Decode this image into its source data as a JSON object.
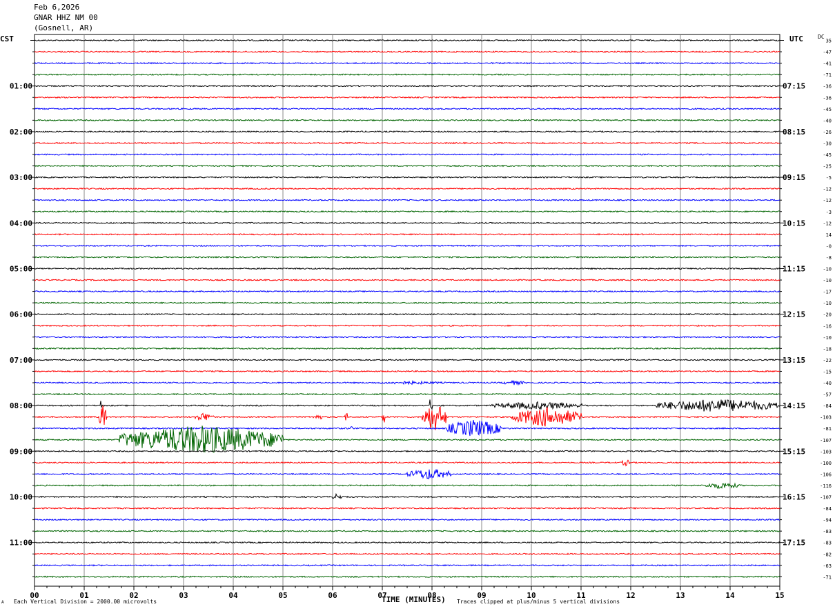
{
  "header": {
    "date": "Feb 6,2026",
    "station": "GNAR HHZ NM 00",
    "location": "(Gosnell, AR)"
  },
  "left_axis_title": "CST",
  "right_axis_title": "UTC",
  "dc_label": "DC",
  "footer": {
    "left_note": "Each Vertical Division = 2000.00 microvolts",
    "right_note": "Traces clipped at plus/minus 5 vertical divisions",
    "corner_mark": "A"
  },
  "chart_data": {
    "type": "line",
    "title": "",
    "xlabel": "TIME (MINUTES)",
    "xlim": [
      0,
      15
    ],
    "x_ticks": [
      "00",
      "01",
      "02",
      "03",
      "04",
      "05",
      "06",
      "07",
      "08",
      "09",
      "10",
      "11",
      "12",
      "13",
      "14",
      "15"
    ],
    "row_minutes": 15,
    "trace_colors": [
      "#000000",
      "#ff0000",
      "#0000ff",
      "#006400"
    ],
    "left_hour_labels": [
      "01:00",
      "02:00",
      "03:00",
      "04:00",
      "05:00",
      "06:00",
      "07:00",
      "08:00",
      "09:00",
      "10:00",
      "11:00"
    ],
    "right_hour_labels": [
      "07:15",
      "08:15",
      "09:15",
      "10:15",
      "11:15",
      "12:15",
      "13:15",
      "14:15",
      "15:15",
      "16:15",
      "17:15"
    ],
    "dc_offsets": [
      "35",
      "-47",
      "-41",
      "-71",
      "-36",
      "-36",
      "-45",
      "-40",
      "-26",
      "-30",
      "-45",
      "-25",
      "-5",
      "-12",
      "-12",
      "-3",
      "-12",
      "14",
      "-0",
      "-8",
      "-10",
      "-10",
      "-17",
      "-10",
      "-20",
      "-16",
      "-10",
      "-18",
      "-22",
      "-15",
      "-40",
      "-57",
      "-84",
      "-103",
      "-81",
      "-107",
      "-103",
      "-100",
      "-106",
      "-116",
      "-107",
      "-84",
      "-94",
      "-83",
      "-83",
      "-82",
      "-63",
      "-71"
    ],
    "events": [
      {
        "row": 32,
        "t_start": 9.2,
        "t_end": 11.1,
        "amplitude": 0.35
      },
      {
        "row": 32,
        "t_start": 12.5,
        "t_end": 15.0,
        "amplitude": 0.6
      },
      {
        "row": 32,
        "t_start": 1.3,
        "t_end": 1.35,
        "amplitude": 0.9
      },
      {
        "row": 32,
        "t_start": 7.95,
        "t_end": 8.0,
        "amplitude": 0.9
      },
      {
        "row": 33,
        "t_start": 1.3,
        "t_end": 1.45,
        "amplitude": 1.2
      },
      {
        "row": 33,
        "t_start": 3.2,
        "t_end": 3.6,
        "amplitude": 0.4
      },
      {
        "row": 33,
        "t_start": 5.6,
        "t_end": 5.8,
        "amplitude": 0.3
      },
      {
        "row": 33,
        "t_start": 6.25,
        "t_end": 6.3,
        "amplitude": 0.6
      },
      {
        "row": 33,
        "t_start": 7.0,
        "t_end": 7.05,
        "amplitude": 0.9
      },
      {
        "row": 33,
        "t_start": 7.8,
        "t_end": 8.3,
        "amplitude": 1.3
      },
      {
        "row": 33,
        "t_start": 9.6,
        "t_end": 11.0,
        "amplitude": 0.9
      },
      {
        "row": 34,
        "t_start": 8.3,
        "t_end": 9.4,
        "amplitude": 0.8
      },
      {
        "row": 34,
        "t_start": 6.35,
        "t_end": 6.4,
        "amplitude": 0.5
      },
      {
        "row": 35,
        "t_start": 1.7,
        "t_end": 5.0,
        "amplitude": 1.3
      },
      {
        "row": 37,
        "t_start": 11.8,
        "t_end": 12.0,
        "amplitude": 0.3
      },
      {
        "row": 38,
        "t_start": 7.5,
        "t_end": 8.4,
        "amplitude": 0.5
      },
      {
        "row": 39,
        "t_start": 13.5,
        "t_end": 14.2,
        "amplitude": 0.3
      },
      {
        "row": 40,
        "t_start": 6.0,
        "t_end": 6.2,
        "amplitude": 0.3
      },
      {
        "row": 30,
        "t_start": 9.4,
        "t_end": 9.9,
        "amplitude": 0.2
      },
      {
        "row": 30,
        "t_start": 6.8,
        "t_end": 8.3,
        "amplitude": 0.15
      }
    ]
  }
}
